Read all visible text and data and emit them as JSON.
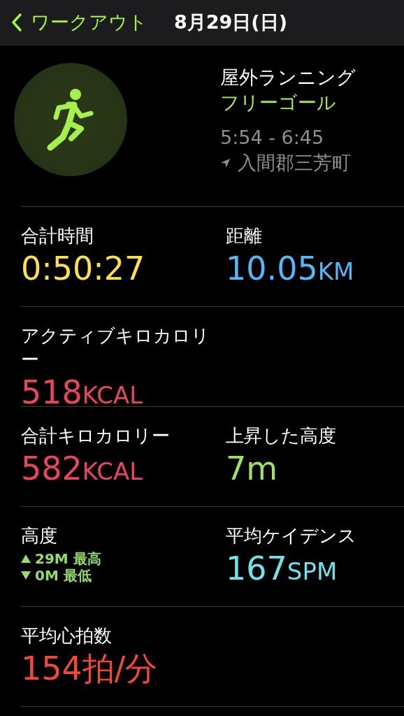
{
  "nav": {
    "back_label": "ワークアウト",
    "title": "8月29日(日)"
  },
  "workout": {
    "name": "屋外ランニング",
    "goal": "フリーゴール",
    "time_range": "5:54 - 6:45",
    "location": "入間郡三芳町"
  },
  "rows": [
    [
      {
        "kind": "metric",
        "label": "合計時間",
        "value": "0:50:27",
        "color": "#fbe14f"
      },
      {
        "kind": "metric",
        "label": "距離",
        "value": "10.05",
        "unit": "KM",
        "color": "#56b7f6"
      }
    ],
    [
      {
        "kind": "metric",
        "label": "アクティブキロカロリー",
        "value": "518",
        "unit": "KCAL",
        "color": "#e9455c"
      }
    ],
    [
      {
        "kind": "metric",
        "label": "合計キロカロリー",
        "value": "582",
        "unit": "KCAL",
        "color": "#e9455c"
      },
      {
        "kind": "metric",
        "label": "上昇した高度",
        "value": "7m",
        "color": "#9fe065"
      }
    ],
    [
      {
        "kind": "elevation",
        "label": "高度",
        "high": "29M",
        "high_label": "最高",
        "low": "0M",
        "low_label": "最低",
        "color": "#94dc6d"
      },
      {
        "kind": "metric",
        "label": "平均ケイデンス",
        "value": "167",
        "unit": "SPM",
        "color": "#70e3ea"
      }
    ],
    [
      {
        "kind": "metric",
        "label": "平均心拍数",
        "value": "154拍/分",
        "color": "#f2483a"
      }
    ]
  ]
}
